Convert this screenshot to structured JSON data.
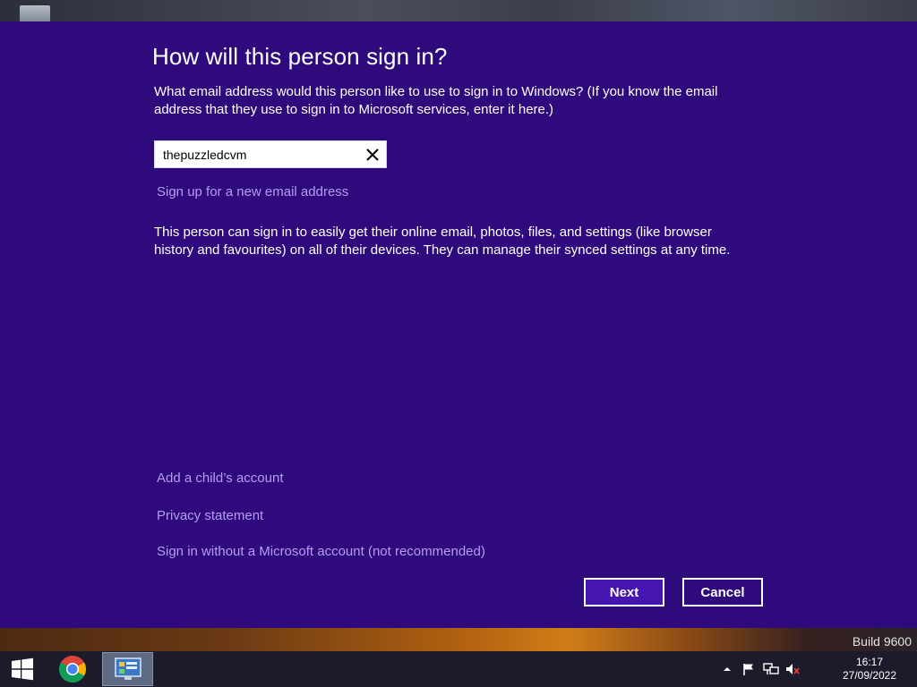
{
  "desktop": {
    "build_label": "Build 9600"
  },
  "dialog": {
    "title": "How will this person sign in?",
    "description": "What email address would this person like to use to sign in to Windows? (If you know the email address that they use to sign in to Microsoft services, enter it here.)",
    "email_value": "thepuzzledcvm",
    "signup_link": "Sign up for a new email address",
    "info_text": "This person can sign in to easily get their online email, photos, files, and settings (like browser history and favourites) on all of their devices. They can manage their synced settings at any time.",
    "child_account_link": "Add a child’s account",
    "privacy_link": "Privacy statement",
    "no_msa_link": "Sign in without a Microsoft account (not recommended)",
    "next_label": "Next",
    "cancel_label": "Cancel"
  },
  "taskbar": {
    "time": "16:17",
    "date": "27/09/2022",
    "icons": [
      "windows-start-icon",
      "chrome-icon",
      "control-panel-icon",
      "tray-up-arrow-icon",
      "action-center-flag-icon",
      "network-icon",
      "volume-muted-icon"
    ]
  },
  "colors": {
    "dialog_bg": "#2e0a7d",
    "link": "#b59cf2",
    "next_button_bg": "#4615b0",
    "taskbar_bg": "#1b1b2b"
  }
}
